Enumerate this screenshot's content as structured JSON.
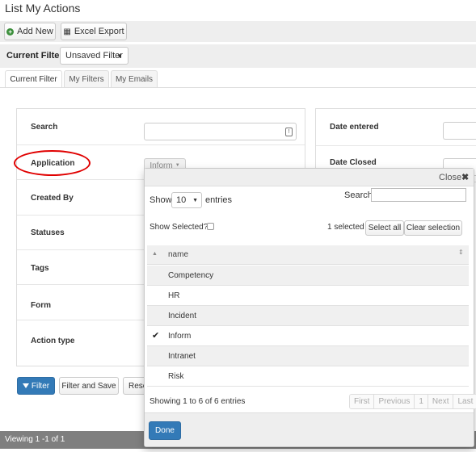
{
  "page": {
    "title": "List My Actions"
  },
  "toolbar": {
    "add_new_label": "Add New",
    "excel_export_label": "Excel Export",
    "add_icon": "plus-circle-icon",
    "excel_icon": "grid-icon"
  },
  "filter": {
    "label": "Current Filter:",
    "value": "Unsaved Filter"
  },
  "tabs": [
    {
      "label": "Current Filter",
      "active": true
    },
    {
      "label": "My Filters",
      "active": false
    },
    {
      "label": "My Emails",
      "active": false
    }
  ],
  "fields_left": [
    {
      "label": "Search"
    },
    {
      "label": "Application"
    },
    {
      "label": "Created By"
    },
    {
      "label": "Statuses"
    },
    {
      "label": "Tags"
    },
    {
      "label": "Form"
    },
    {
      "label": "Action type"
    }
  ],
  "fields_right": [
    {
      "label": "Date entered"
    },
    {
      "label": "Date Closed"
    }
  ],
  "application_button": {
    "label": "Inform"
  },
  "actions": {
    "filter_label": "Filter",
    "filter_save_label": "Filter and Save",
    "reset_label": "Reset"
  },
  "footer": {
    "text": "Viewing 1 -1 of 1"
  },
  "dropdown": {
    "close_label": "Close",
    "close_icon": "close-icon",
    "show_label": "Show",
    "page_length": "10",
    "entries_label": "entries",
    "search_label": "Search:",
    "search_value": "",
    "show_selected_label": "Show Selected?",
    "selected_count": "1 selected",
    "select_all_label": "Select all",
    "clear_selection_label": "Clear selection",
    "column_header": "name",
    "rows": [
      {
        "name": "Competency",
        "selected": false
      },
      {
        "name": "HR",
        "selected": false
      },
      {
        "name": "Incident",
        "selected": false
      },
      {
        "name": "Inform",
        "selected": true
      },
      {
        "name": "Intranet",
        "selected": false
      },
      {
        "name": "Risk",
        "selected": false
      }
    ],
    "info": "Showing 1 to 6 of 6 entries",
    "pager": [
      "First",
      "Previous",
      "1",
      "Next",
      "Last"
    ],
    "done_label": "Done"
  },
  "colors": {
    "primary": "#337ab7",
    "highlight": "#e00000",
    "toolbar_bg": "#eeeeee",
    "footer_bg": "#7f7f7f"
  }
}
